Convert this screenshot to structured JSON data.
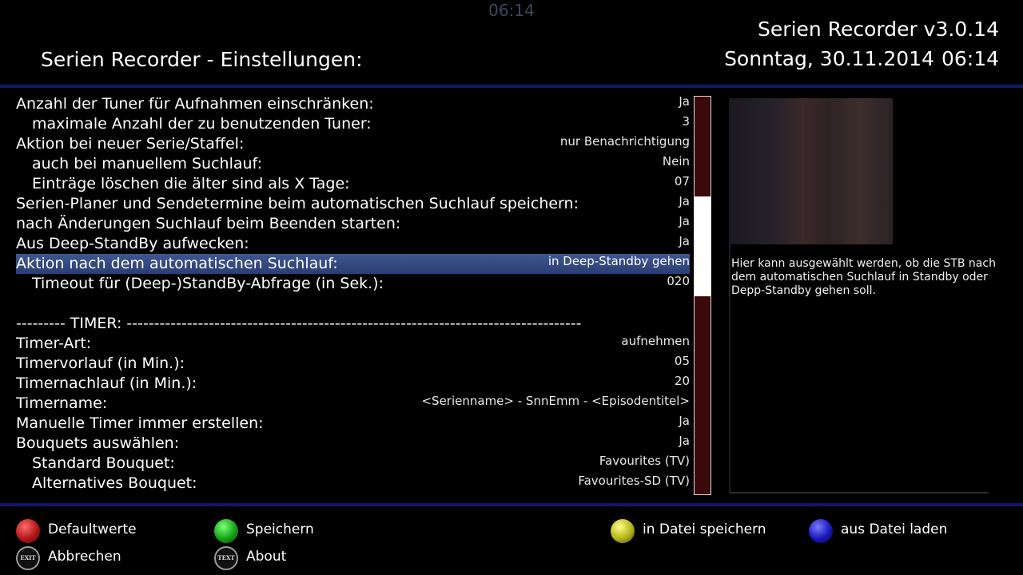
{
  "header": {
    "clock": "06:14",
    "title": "Serien Recorder - Einstellungen:",
    "version": "Serien Recorder v3.0.14",
    "date": "Sonntag, 30.11.2014",
    "time": "06:14"
  },
  "settings": [
    {
      "label": "Anzahl der Tuner für Aufnahmen einschränken:",
      "value": "Ja"
    },
    {
      "label": "maximale Anzahl der zu benutzenden Tuner:",
      "value": "3"
    },
    {
      "label": "Aktion bei neuer Serie/Staffel:",
      "value": "nur Benachrichtigung"
    },
    {
      "label": "auch bei manuellem Suchlauf:",
      "value": "Nein"
    },
    {
      "label": "Einträge löschen die älter sind als X Tage:",
      "value": "07"
    },
    {
      "label": "Serien-Planer und Sendetermine beim automatischen Suchlauf speichern:",
      "value": "Ja"
    },
    {
      "label": "nach Änderungen Suchlauf beim Beenden starten:",
      "value": "Ja"
    },
    {
      "label": "Aus Deep-StandBy aufwecken:",
      "value": "Ja"
    },
    {
      "label": "Aktion nach dem automatischen Suchlauf:",
      "value": "in Deep-Standby gehen"
    },
    {
      "label": "Timeout für (Deep-)StandBy-Abfrage (in Sek.):",
      "value": "020"
    },
    {
      "label": "",
      "value": ""
    },
    {
      "label": "---------  TIMER: -----------------------------------------------------------------------------------",
      "value": ""
    },
    {
      "label": "Timer-Art:",
      "value": "aufnehmen"
    },
    {
      "label": "Timervorlauf (in Min.):",
      "value": "05"
    },
    {
      "label": "Timernachlauf (in Min.):",
      "value": "20"
    },
    {
      "label": "Timername:",
      "value": "<Serienname> - SnnEmm - <Episodentitel>"
    },
    {
      "label": "Manuelle Timer immer erstellen:",
      "value": "Ja"
    },
    {
      "label": "Bouquets auswählen:",
      "value": "Ja"
    },
    {
      "label": "Standard Bouquet:",
      "value": "Favourites (TV)"
    },
    {
      "label": "Alternatives Bouquet:",
      "value": "Favourites-SD (TV)"
    }
  ],
  "scroll_position": 0.25,
  "scroll_visible_fraction": 0.25,
  "help_text": "Hier kann ausgewählt werden, ob die STB nach dem automatischen Suchlauf in Standby oder Depp-Standby gehen soll.",
  "buttons": {
    "red": "Defaultwerte",
    "green": "Speichern",
    "yellow": "in Datei speichern",
    "blue": "aus Datei laden",
    "exit": "Abbrechen",
    "text": "About",
    "exit_icon_text": "EXIT",
    "text_icon_text": "TEXT"
  },
  "colors": {
    "selection": "#3e5690",
    "divider": "#0f1a6e",
    "scrollbar_track": "#3a0a0a"
  }
}
